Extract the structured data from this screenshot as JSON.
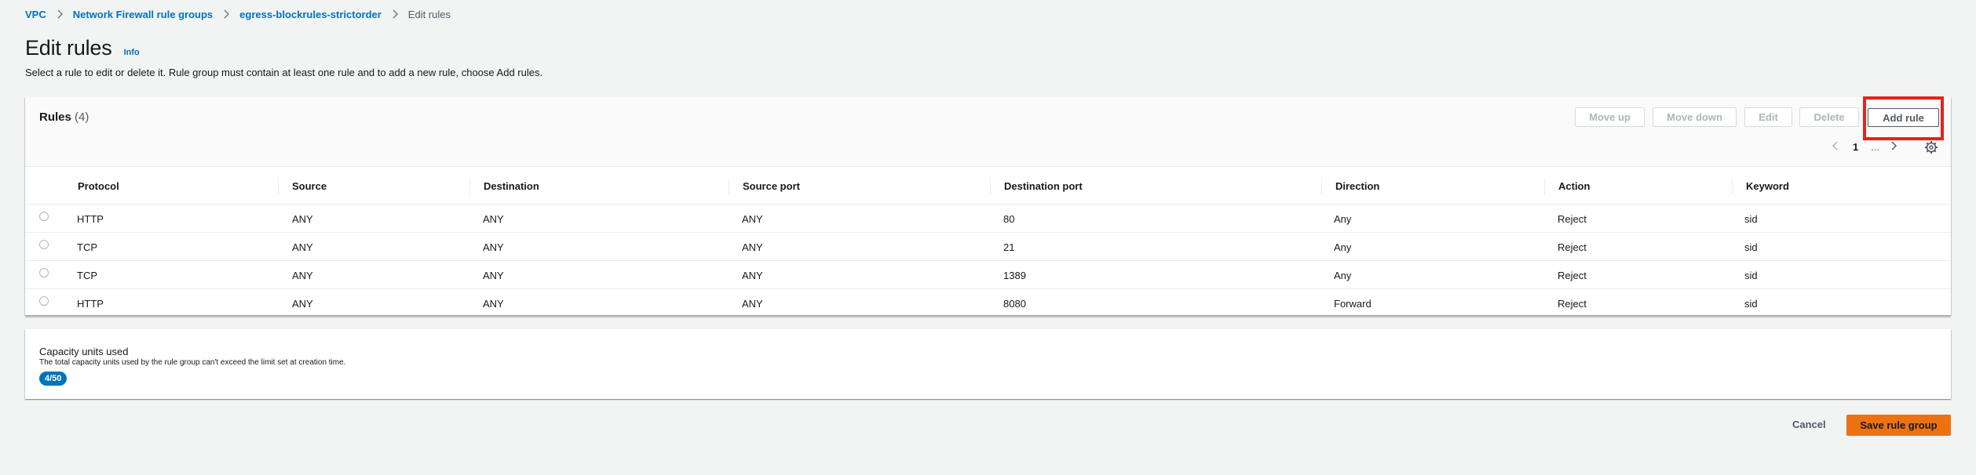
{
  "breadcrumb": {
    "items": [
      "VPC",
      "Network Firewall rule groups",
      "egress-blockrules-strictorder"
    ],
    "current": "Edit rules"
  },
  "header": {
    "title": "Edit rules",
    "info": "Info",
    "description": "Select a rule to edit or delete it. Rule group must contain at least one rule and to add a new rule, choose Add rules."
  },
  "rules": {
    "title": "Rules",
    "count": "(4)",
    "buttons": {
      "move_up": "Move up",
      "move_down": "Move down",
      "edit": "Edit",
      "delete": "Delete",
      "add_rule": "Add rule"
    },
    "pagination": {
      "page": "1",
      "ellipsis": "..."
    },
    "columns": [
      "Protocol",
      "Source",
      "Destination",
      "Source port",
      "Destination port",
      "Direction",
      "Action",
      "Keyword"
    ],
    "rows": [
      [
        "HTTP",
        "ANY",
        "ANY",
        "ANY",
        "80",
        "Any",
        "Reject",
        "sid"
      ],
      [
        "TCP",
        "ANY",
        "ANY",
        "ANY",
        "21",
        "Any",
        "Reject",
        "sid"
      ],
      [
        "TCP",
        "ANY",
        "ANY",
        "ANY",
        "1389",
        "Any",
        "Reject",
        "sid"
      ],
      [
        "HTTP",
        "ANY",
        "ANY",
        "ANY",
        "8080",
        "Forward",
        "Reject",
        "sid"
      ]
    ]
  },
  "capacity": {
    "title": "Capacity units used",
    "description": "The total capacity units used by the rule group can't exceed the limit set at creation time.",
    "badge": "4/50"
  },
  "footer": {
    "cancel": "Cancel",
    "save": "Save rule group"
  },
  "colors": {
    "link": "#0073bb",
    "primary": "#ec7211",
    "highlight": "#e3241b",
    "badge": "#0073bb"
  },
  "icons": [
    "chevron-right-icon",
    "chevron-left-icon",
    "gear-icon"
  ]
}
